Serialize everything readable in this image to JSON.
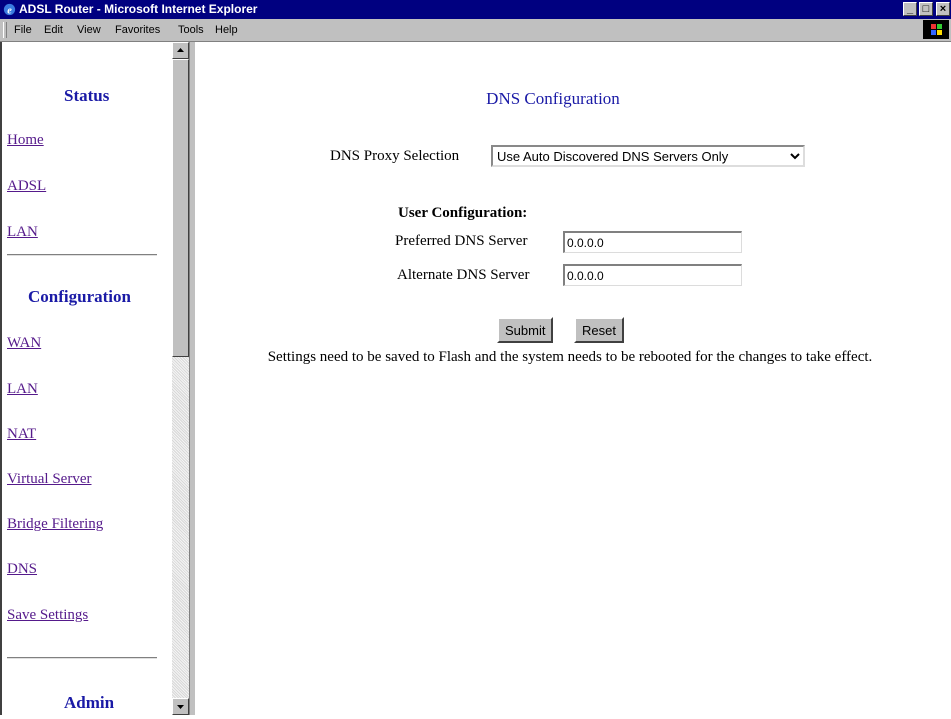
{
  "window": {
    "title": "ADSL Router - Microsoft Internet Explorer",
    "buttons": [
      "_",
      "□",
      "×"
    ]
  },
  "menubar": {
    "items": [
      "File",
      "Edit",
      "View",
      "Favorites",
      "Tools",
      "Help"
    ]
  },
  "nav": {
    "status_heading": "Status",
    "status_links": [
      "Home",
      "ADSL",
      "LAN"
    ],
    "config_heading": "Configuration",
    "config_links": [
      "WAN",
      "LAN",
      "NAT",
      "Virtual Server",
      "Bridge Filtering",
      "DNS",
      "Save Settings"
    ],
    "admin_heading": "Admin"
  },
  "main": {
    "title": "DNS Configuration",
    "proxy_label": "DNS Proxy Selection",
    "proxy_selected": "Use Auto Discovered DNS Servers Only",
    "user_config_heading": "User Configuration:",
    "preferred_label": "Preferred DNS Server",
    "preferred_value": "0.0.0.0",
    "alternate_label": "Alternate DNS Server",
    "alternate_value": "0.0.0.0",
    "submit_label": "Submit",
    "reset_label": "Reset",
    "note": "Settings need to be saved to Flash and the system needs to be rebooted for the changes to take effect."
  }
}
